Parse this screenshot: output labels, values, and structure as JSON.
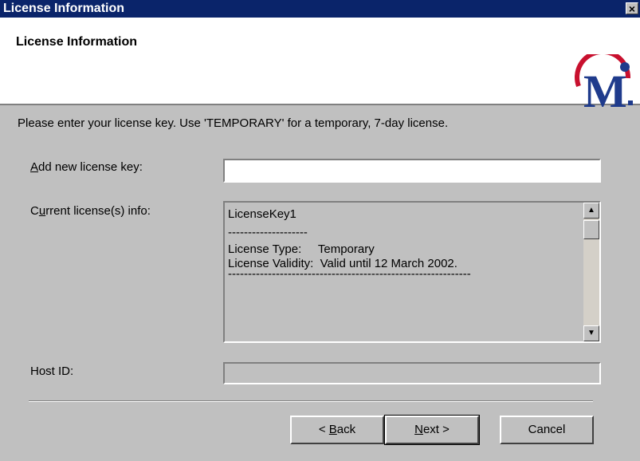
{
  "window": {
    "title": "License Information",
    "close_label": "×"
  },
  "header": {
    "heading": "License Information",
    "logo_letter": "M"
  },
  "instruction": "Please enter your license key. Use 'TEMPORARY' for a temporary, 7-day license.",
  "add_key": {
    "label_prefix": "",
    "label_accel": "A",
    "label_rest": "dd new license key:",
    "value": ""
  },
  "current": {
    "label_prefix": "C",
    "label_accel": "u",
    "label_rest": "rrent license(s) info:",
    "lines": [
      "LicenseKey1",
      "--------------------",
      "License Type:     Temporary",
      "License Validity:  Valid until 12 March 2002.",
      "-------------------------------------------------------------"
    ]
  },
  "host_id": {
    "label": "Host ID:",
    "value": ""
  },
  "buttons": {
    "back": {
      "prefix": "< ",
      "accel": "B",
      "rest": "ack"
    },
    "next": {
      "prefix": "",
      "accel": "N",
      "rest": "ext >"
    },
    "cancel": "Cancel"
  },
  "colors": {
    "titlebar": "#0a246a",
    "dialog": "#c0c0c0",
    "logo_red": "#c8102e",
    "logo_blue": "#1f3b8c"
  }
}
